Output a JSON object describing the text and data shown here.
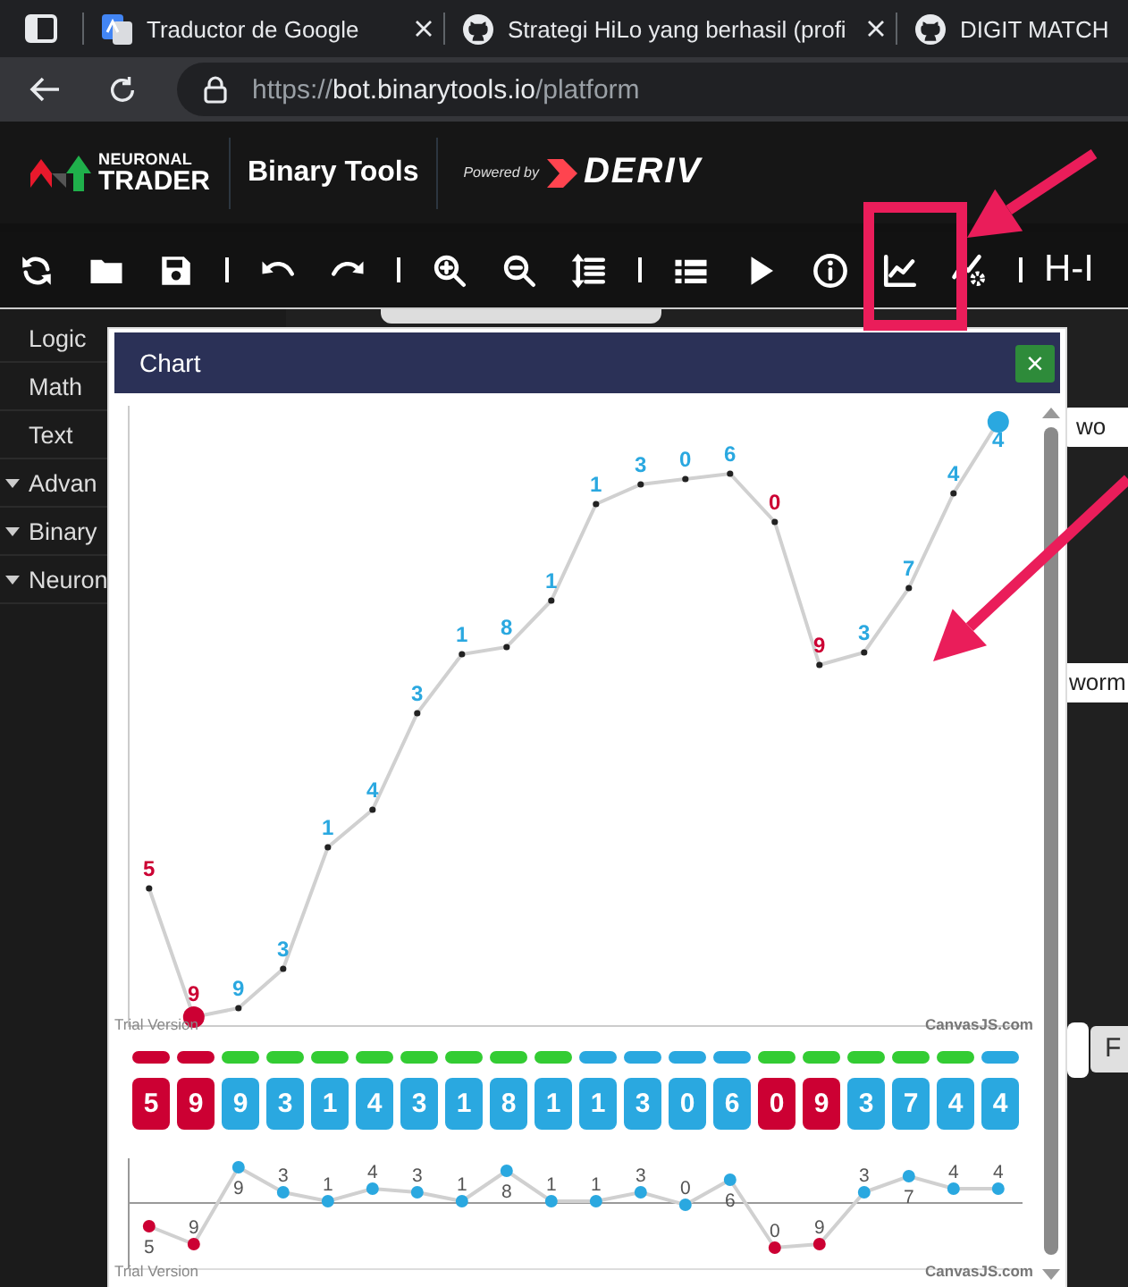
{
  "browser": {
    "tabs": [
      {
        "title": "Traductor de Google"
      },
      {
        "title": "Strategi HiLo yang berhasil (profi"
      },
      {
        "title": "DIGIT MATCH"
      }
    ],
    "url": {
      "scheme": "https://",
      "host": "bot.binarytools.io",
      "path": "/platform"
    }
  },
  "header": {
    "logo_top": "NEURONAL",
    "logo_bottom": "TRADER",
    "title": "Binary Tools",
    "powered_by": "Powered by",
    "brand": "DERIV"
  },
  "toolbar": {
    "items": [
      {
        "kind": "refresh"
      },
      {
        "kind": "folder"
      },
      {
        "kind": "save"
      },
      {
        "kind": "separator"
      },
      {
        "kind": "undo"
      },
      {
        "kind": "redo"
      },
      {
        "kind": "separator"
      },
      {
        "kind": "zoom_in"
      },
      {
        "kind": "zoom_out"
      },
      {
        "kind": "sort"
      },
      {
        "kind": "separator"
      },
      {
        "kind": "list"
      },
      {
        "kind": "play"
      },
      {
        "kind": "info"
      },
      {
        "kind": "chart"
      },
      {
        "kind": "chart_settings"
      },
      {
        "kind": "separator"
      }
    ],
    "trailing_text": "H-I"
  },
  "sidebar": {
    "items": [
      {
        "label": "Logic",
        "has_children": false
      },
      {
        "label": "Math",
        "has_children": false
      },
      {
        "label": "Text",
        "has_children": false
      },
      {
        "label": "Advan",
        "has_children": true
      },
      {
        "label": "Binary",
        "has_children": true
      },
      {
        "label": "Neuron",
        "has_children": true
      }
    ]
  },
  "workspace": {
    "blocks": [
      {
        "kind": "strip"
      },
      {
        "kind": "field",
        "text": "wo"
      },
      {
        "kind": "field",
        "text": "worm"
      },
      {
        "kind": "field"
      },
      {
        "kind": "button",
        "text": "F"
      }
    ]
  },
  "chart_dialog": {
    "title": "Chart",
    "close_label": "×",
    "main_credits": [
      "Trial Version",
      "CanvasJS.com"
    ],
    "mini_credits": [
      "Trial Version",
      "CanvasJS.com"
    ],
    "ticks": [
      {
        "label": "5",
        "tile": "5",
        "mini_label": "5",
        "color": "#cc0033",
        "bar": {
          "color": "#cc0033"
        }
      },
      {
        "label": "9",
        "tile": "9",
        "mini_label": "9",
        "color": "#cc0033",
        "bar": {
          "color": "#cc0033"
        }
      },
      {
        "label": "9",
        "tile": "9",
        "mini_label": "9",
        "color": "#2aa8e0",
        "bar": {
          "color": "#33cc33"
        }
      },
      {
        "label": "3",
        "tile": "3",
        "mini_label": "3",
        "color": "#2aa8e0",
        "bar": {
          "color": "#33cc33"
        }
      },
      {
        "label": "1",
        "tile": "1",
        "mini_label": "1",
        "color": "#2aa8e0",
        "bar": {
          "color": "#33cc33"
        }
      },
      {
        "label": "4",
        "tile": "4",
        "mini_label": "4",
        "color": "#2aa8e0",
        "bar": {
          "color": "#33cc33"
        }
      },
      {
        "label": "3",
        "tile": "3",
        "mini_label": "3",
        "color": "#2aa8e0",
        "bar": {
          "color": "#33cc33"
        }
      },
      {
        "label": "1",
        "tile": "1",
        "mini_label": "1",
        "color": "#2aa8e0",
        "bar": {
          "color": "#33cc33"
        }
      },
      {
        "label": "8",
        "tile": "8",
        "mini_label": "8",
        "color": "#2aa8e0",
        "bar": {
          "color": "#33cc33"
        }
      },
      {
        "label": "1",
        "tile": "1",
        "mini_label": "1",
        "color": "#2aa8e0",
        "bar": {
          "color": "#33cc33"
        }
      },
      {
        "label": "1",
        "tile": "1",
        "mini_label": "1",
        "color": "#2aa8e0",
        "bar": {
          "color": "#2aa8e0"
        }
      },
      {
        "label": "3",
        "tile": "3",
        "mini_label": "3",
        "color": "#2aa8e0",
        "bar": {
          "color": "#2aa8e0"
        }
      },
      {
        "label": "0",
        "tile": "0",
        "mini_label": "0",
        "color": "#2aa8e0",
        "bar": {
          "color": "#2aa8e0"
        }
      },
      {
        "label": "6",
        "tile": "6",
        "mini_label": "6",
        "color": "#2aa8e0",
        "bar": {
          "color": "#2aa8e0"
        }
      },
      {
        "label": "0",
        "tile": "0",
        "mini_label": "0",
        "color": "#cc0033",
        "bar": {
          "color": "#33cc33"
        }
      },
      {
        "label": "9",
        "tile": "9",
        "mini_label": "9",
        "color": "#cc0033",
        "bar": {
          "color": "#33cc33"
        }
      },
      {
        "label": "3",
        "tile": "3",
        "mini_label": "3",
        "color": "#2aa8e0",
        "bar": {
          "color": "#33cc33"
        }
      },
      {
        "label": "7",
        "tile": "7",
        "mini_label": "7",
        "color": "#2aa8e0",
        "bar": {
          "color": "#33cc33"
        }
      },
      {
        "label": "4",
        "tile": "4",
        "mini_label": "4",
        "color": "#2aa8e0",
        "bar": {
          "color": "#33cc33"
        }
      },
      {
        "label": "4",
        "tile": "4",
        "mini_label": "4",
        "color": "#2aa8e0",
        "bar": {
          "color": "#2aa8e0"
        }
      }
    ]
  },
  "annotations": [
    {
      "kind": "box"
    },
    {
      "kind": "arrow"
    },
    {
      "kind": "arrow"
    }
  ]
}
